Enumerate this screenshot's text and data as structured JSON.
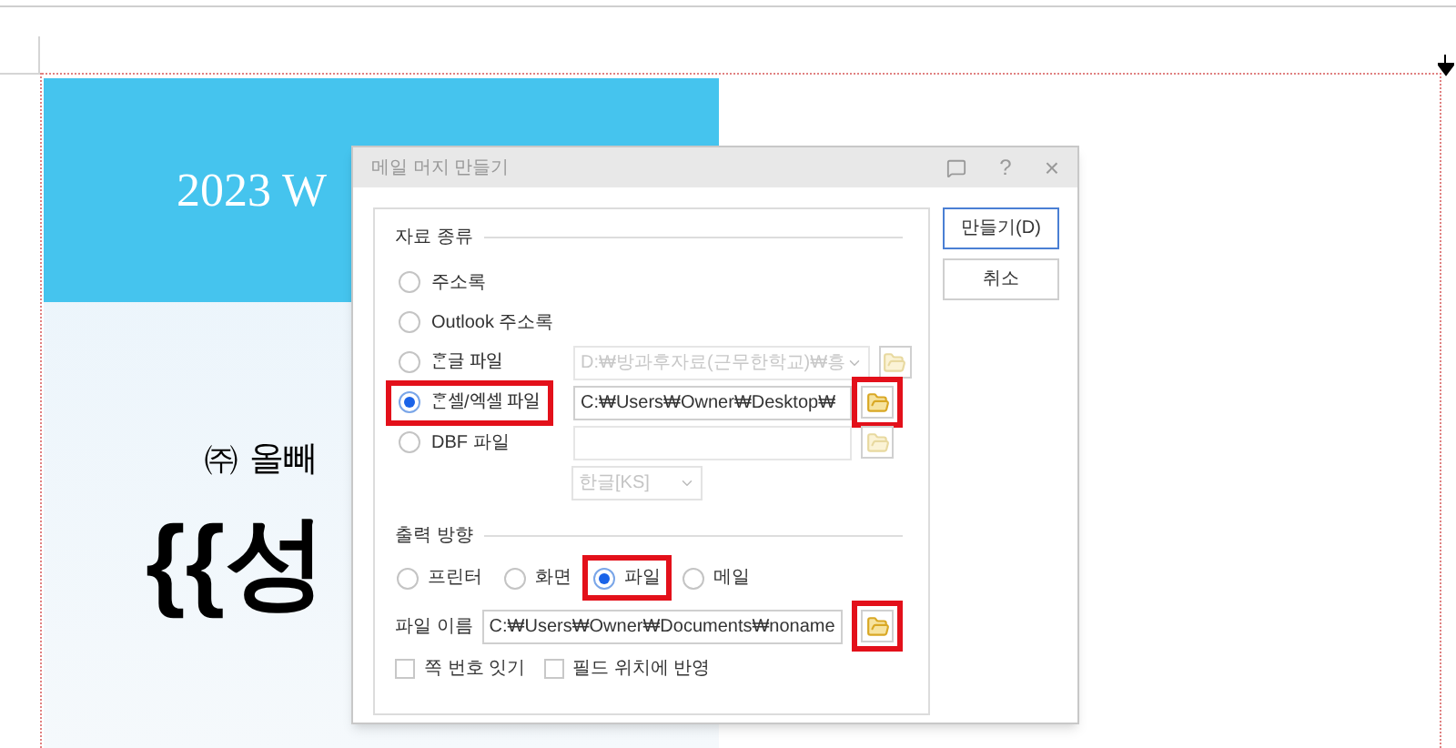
{
  "document": {
    "header_text": "2023 W",
    "company_text": "㈜ 올빼",
    "merge_field_text": "{{성"
  },
  "dialog": {
    "title": "메일 머지 만들기",
    "help_glyph": "?",
    "close_glyph": "×",
    "data_source": {
      "heading": "자료 종류",
      "options": [
        {
          "kind": "plain",
          "label": "주소록",
          "selected": false,
          "highlighted": false
        },
        {
          "kind": "plain",
          "label": "Outlook 주소록",
          "selected": false,
          "highlighted": false
        },
        {
          "kind": "file",
          "label": "ᄒᆞᆫ글 파일",
          "selected": false,
          "highlighted": false,
          "path": "D:₩방과후자료(근무한학교)₩흥",
          "disabled": true,
          "dropdown": true,
          "folder_highlighted": false
        },
        {
          "kind": "file",
          "label": "ᄒᆞᆫ셀/엑셀 파일",
          "selected": true,
          "highlighted": true,
          "path": "C:₩Users₩Owner₩Desktop₩",
          "disabled": false,
          "dropdown": false,
          "folder_highlighted": true
        },
        {
          "kind": "file",
          "label": "DBF 파일",
          "selected": false,
          "highlighted": false,
          "disabled": true,
          "dropdown": false,
          "folder_highlighted": false
        }
      ],
      "encoding": {
        "value": "한글[KS]",
        "disabled": true
      }
    },
    "output": {
      "heading": "출력 방향",
      "options": [
        {
          "label": "프린터",
          "selected": false,
          "highlighted": false
        },
        {
          "label": "화면",
          "selected": false,
          "highlighted": false
        },
        {
          "label": "파일",
          "selected": true,
          "highlighted": true
        },
        {
          "label": "메일",
          "selected": false,
          "highlighted": false
        }
      ],
      "filename_label": "파일 이름",
      "filename": "C:₩Users₩Owner₩Documents₩noname",
      "folder_highlighted": true,
      "checkboxes": [
        {
          "label": "쪽 번호 잇기",
          "checked": false
        },
        {
          "label": "필드 위치에 반영",
          "checked": false
        }
      ]
    },
    "buttons": [
      {
        "label": "만들기(D)",
        "default": true
      },
      {
        "label": "취소",
        "default": false
      }
    ]
  }
}
